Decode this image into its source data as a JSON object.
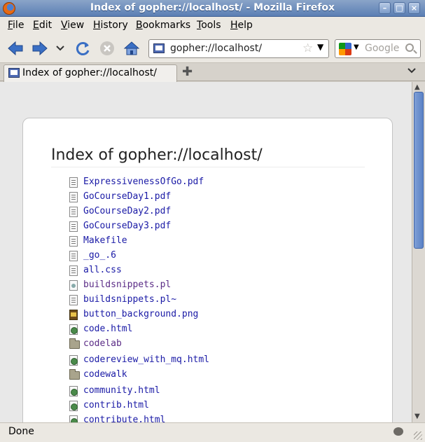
{
  "window": {
    "title": "Index of gopher://localhost/ - Mozilla Firefox"
  },
  "menu": [
    "File",
    "Edit",
    "View",
    "History",
    "Bookmarks",
    "Tools",
    "Help"
  ],
  "navigation": {
    "url": "gopher://localhost/",
    "search_placeholder": "Google"
  },
  "tab": {
    "label": "Index of gopher://localhost/"
  },
  "page": {
    "heading": "Index of gopher://localhost/",
    "files": [
      {
        "name": "ExpressivenessOfGo.pdf",
        "icon": "document-icon",
        "visited": false
      },
      {
        "name": "GoCourseDay1.pdf",
        "icon": "document-icon",
        "visited": false
      },
      {
        "name": "GoCourseDay2.pdf",
        "icon": "document-icon",
        "visited": false
      },
      {
        "name": "GoCourseDay3.pdf",
        "icon": "document-icon",
        "visited": false
      },
      {
        "name": "Makefile",
        "icon": "text-file-icon",
        "visited": false
      },
      {
        "name": "_go_.6",
        "icon": "text-file-icon",
        "visited": false
      },
      {
        "name": "all.css",
        "icon": "text-file-icon",
        "visited": false
      },
      {
        "name": "buildsnippets.pl",
        "icon": "script-file-icon",
        "visited": true
      },
      {
        "name": "buildsnippets.pl~",
        "icon": "text-file-icon",
        "visited": false
      },
      {
        "name": "button_background.png",
        "icon": "image-file-icon",
        "visited": false
      },
      {
        "name": "code.html",
        "icon": "html-file-icon",
        "visited": false
      },
      {
        "name": "codelab",
        "icon": "folder-icon",
        "visited": true
      },
      {
        "name": "codereview_with_mq.html",
        "icon": "html-file-icon",
        "visited": false
      },
      {
        "name": "codewalk",
        "icon": "folder-icon",
        "visited": false
      },
      {
        "name": "community.html",
        "icon": "html-file-icon",
        "visited": false
      },
      {
        "name": "contrib.html",
        "icon": "html-file-icon",
        "visited": false
      },
      {
        "name": "contribute.html",
        "icon": "html-file-icon",
        "visited": false
      }
    ]
  },
  "status": {
    "text": "Done"
  }
}
